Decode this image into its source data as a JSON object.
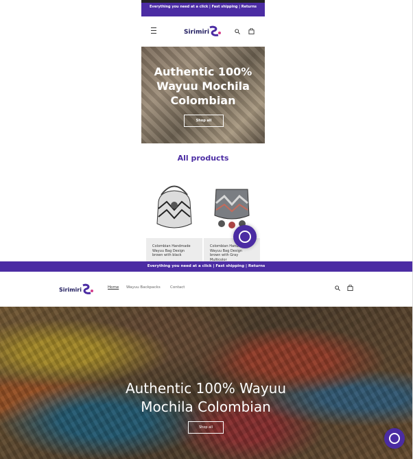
{
  "mobile": {
    "announcement": "Everything you need at a click | Fast shipping | Returns",
    "logo_text": "Sirimiri",
    "hero_title": "Authentic 100% Wayuu Mochila Colombian",
    "shop_all": "Shop all",
    "section_title": "All products",
    "products": [
      {
        "name": "Colombian Handmade Wayuu Bag Design brown with black"
      },
      {
        "name": "Colombian Handmade Wayuu Bag Design brown with Gray Multicolor"
      }
    ],
    "icons": {
      "menu": "menu-icon",
      "search": "search-icon",
      "cart": "cart-icon",
      "whatsapp": "whatsapp-icon"
    }
  },
  "desktop": {
    "announcement": "Everything you need at a click | Fast shipping | Returns",
    "logo_text": "Sirimiri",
    "nav": {
      "home": "Home",
      "bags": "Wayuu Backpacks",
      "contact": "Contact"
    },
    "hero_title": "Authentic 100% Wayuu Mochila Colombian",
    "shop_all": "Shop all",
    "icons": {
      "search": "search-icon",
      "cart": "cart-icon",
      "whatsapp": "whatsapp-icon"
    }
  },
  "colors": {
    "brand": "#4b2ca3",
    "hero_text": "#ffffff"
  }
}
